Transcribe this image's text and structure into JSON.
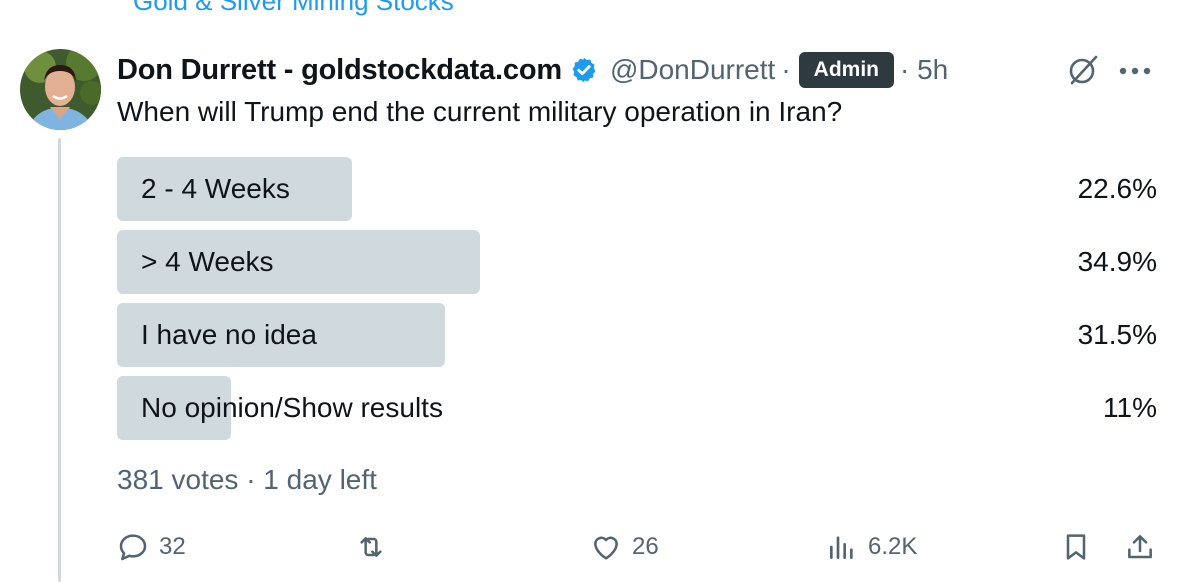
{
  "community": {
    "label": "Gold & Silver Mining Stocks"
  },
  "author": {
    "name": "Don Durrett - goldstockdata.com",
    "handle": "@DonDurrett",
    "separator": "·",
    "badge": "Admin",
    "time": "· 5h",
    "verified": true
  },
  "tweet": {
    "text": "When will Trump end the current military operation in Iran?"
  },
  "poll": {
    "options": [
      {
        "label": "2 - 4 Weeks",
        "percent_label": "22.6%",
        "fraction": 0.226
      },
      {
        "label": "> 4 Weeks",
        "percent_label": "34.9%",
        "fraction": 0.349
      },
      {
        "label": "I have no idea",
        "percent_label": "31.5%",
        "fraction": 0.315
      },
      {
        "label": "No opinion/Show results",
        "percent_label": "11%",
        "fraction": 0.11
      }
    ],
    "meta": "381 votes · 1 day left"
  },
  "actions": {
    "replies": "32",
    "likes": "26",
    "views": "6.2K"
  },
  "colors": {
    "accent": "#1d9bf0",
    "poll_bar": "#cfd9de",
    "muted_text": "#536471",
    "badge_bg": "#2f3940"
  },
  "icons": {
    "verified": "verified-badge-icon",
    "grok": "grok-icon",
    "more": "more-icon",
    "reply": "reply-icon",
    "retweet": "retweet-icon",
    "like": "like-icon",
    "views": "views-icon",
    "bookmark": "bookmark-icon",
    "share": "share-icon"
  }
}
